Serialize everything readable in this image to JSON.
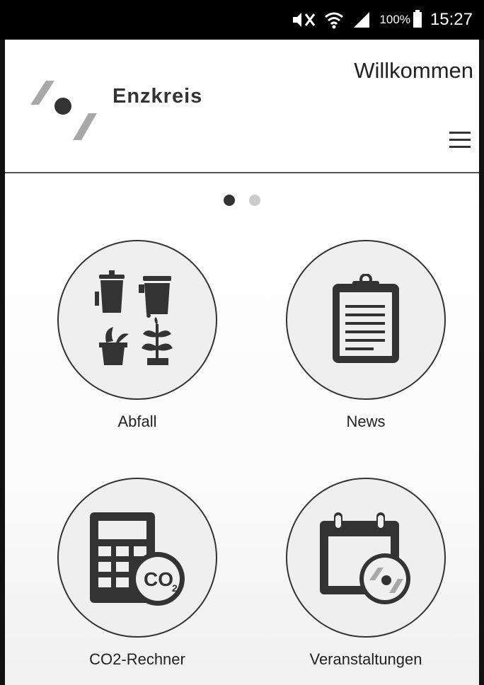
{
  "status_bar": {
    "icons": [
      "mute-icon",
      "wifi-icon",
      "signal-icon",
      "battery-icon"
    ],
    "battery": "100%",
    "time": "15:27"
  },
  "header": {
    "brand": "Enzkreis",
    "welcome": "Willkommen",
    "menu_icon": "hamburger-menu-icon"
  },
  "pager": {
    "pages": 2,
    "active": 1
  },
  "tiles": [
    {
      "label": "Abfall",
      "icon": "waste-bins-icon"
    },
    {
      "label": "News",
      "icon": "clipboard-icon"
    },
    {
      "label": "CO2-Rechner",
      "icon": "co2-calculator-icon"
    },
    {
      "label": "Veranstaltungen",
      "icon": "calendar-icon"
    }
  ],
  "colors": {
    "icon_dark": "#333333",
    "circle_bg": "#efefef",
    "logo_gray": "#a8a8a8"
  }
}
